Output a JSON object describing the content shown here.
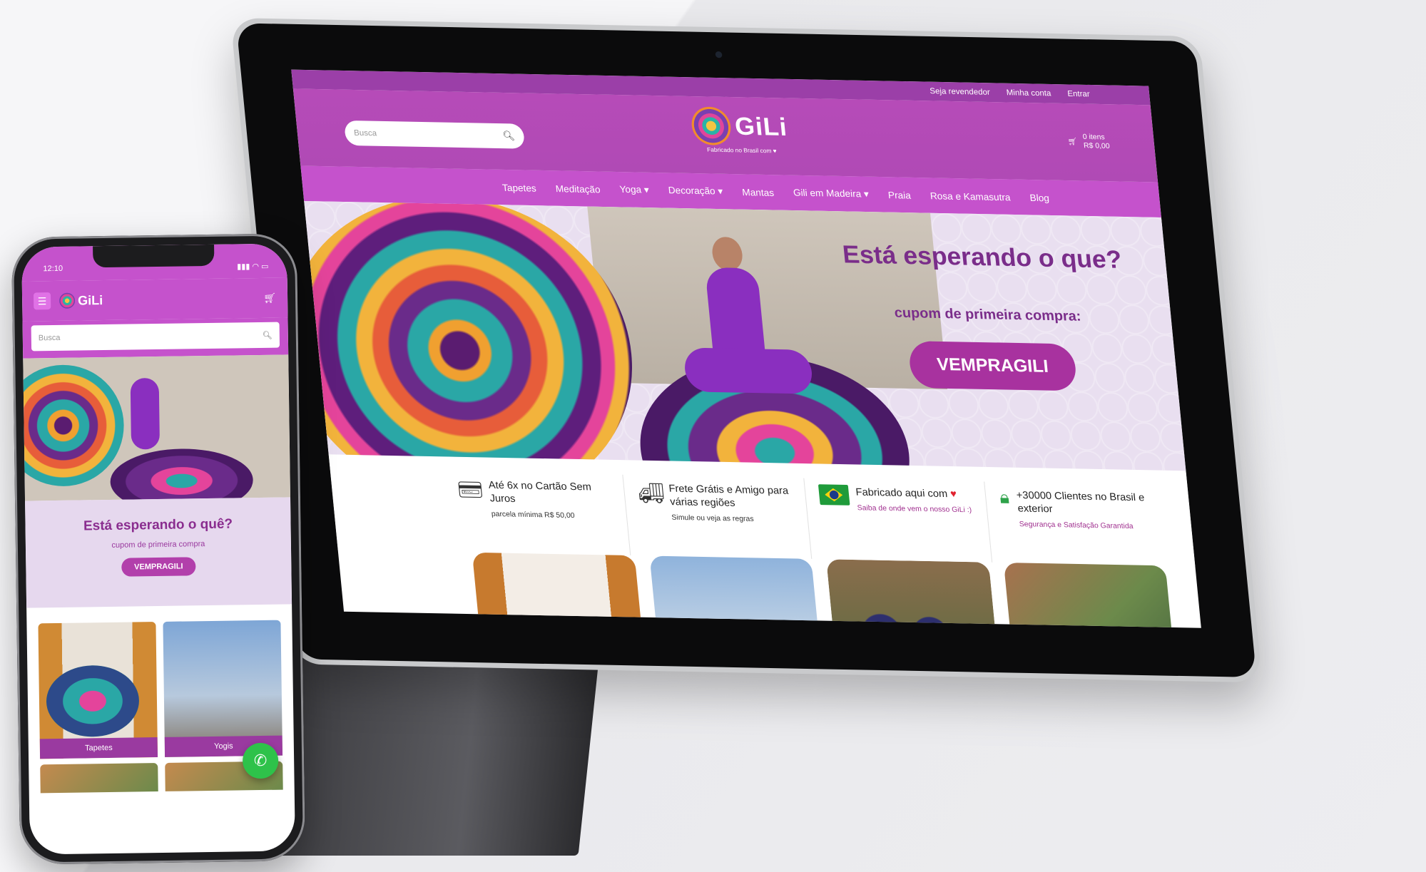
{
  "tablet": {
    "topbar": {
      "links": [
        "Seja revendedor",
        "Minha conta",
        "Entrar"
      ]
    },
    "header": {
      "search_placeholder": "Busca",
      "logo_text": "GiLi",
      "logo_tagline": "Fabricado no Brasil com ♥",
      "cart_line1": "0 itens",
      "cart_line2": "R$ 0,00"
    },
    "nav": {
      "items": [
        "Tapetes",
        "Meditação",
        "Yoga ▾",
        "Decoração ▾",
        "Mantas",
        "Gili em Madeira ▾",
        "Praia",
        "Rosa e Kamasutra",
        "Blog"
      ]
    },
    "hero": {
      "title": "Está esperando o que?",
      "subtitle": "cupom de primeira compra:",
      "cta": "VEMPRAGILI"
    },
    "features": [
      {
        "icon": "credit-card-icon",
        "title": "Até 6x no Cartão Sem Juros",
        "sub": "parcela mínima R$ 50,00"
      },
      {
        "icon": "truck-icon",
        "title": "Frete Grátis e Amigo para várias regiões",
        "sub": "Simule ou veja as regras"
      },
      {
        "icon": "brazil-flag-icon",
        "title": "Fabricado aqui com",
        "sub": "Saiba de onde vem o nosso GiLi :)"
      },
      {
        "icon": "lock-icon",
        "title": "+30000 Clientes no Brasil e exterior",
        "sub": "Segurança e Satisfação Garantida"
      }
    ]
  },
  "phone": {
    "status_time": "12:10",
    "status_icons": "▮▮▮ ◠ ▭",
    "logo_text": "GiLi",
    "search_placeholder": "Busca",
    "promo_title": "Está esperando o quê?",
    "promo_sub": "cupom de primeira compra",
    "promo_cta": "VEMPRAGILI",
    "categories": [
      "Tapetes",
      "Yogis"
    ]
  },
  "colors": {
    "brand_purple": "#b04ab5",
    "nav_purple": "#c552cc",
    "topbar_purple": "#9b3fa8",
    "cta_purple": "#a8329f",
    "whatsapp_green": "#2ec24a"
  }
}
